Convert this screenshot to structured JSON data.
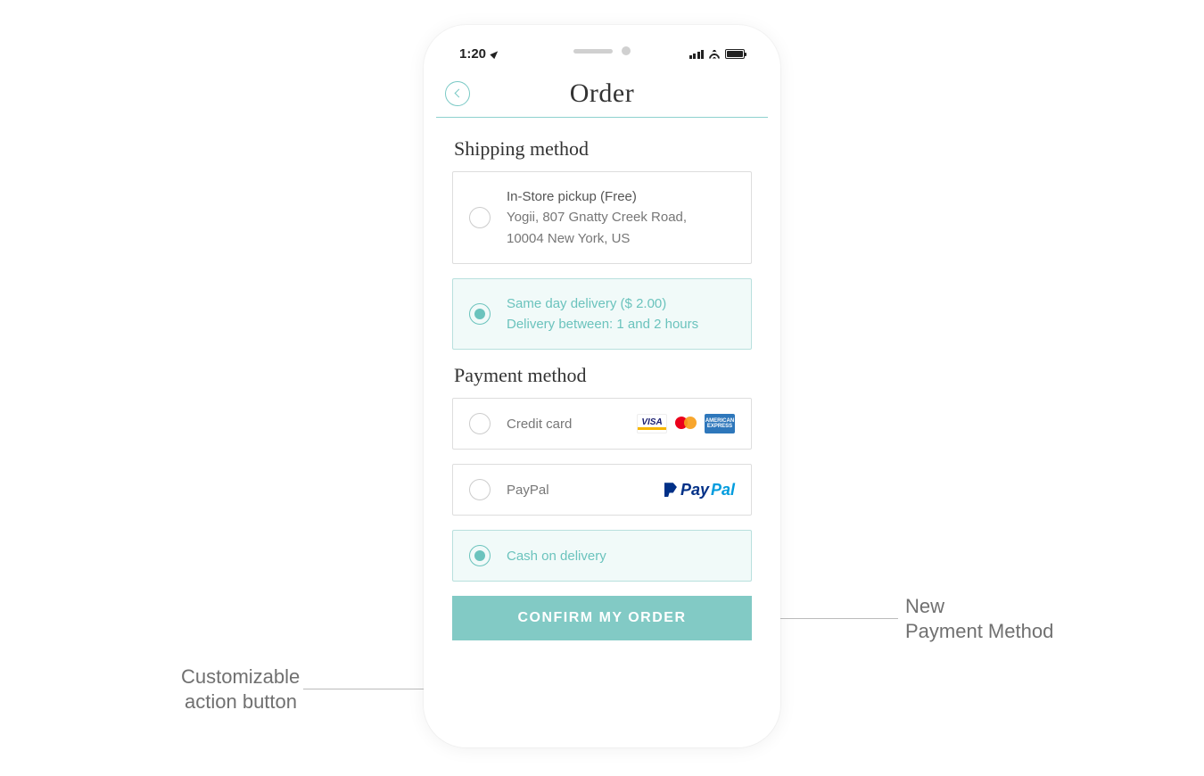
{
  "status": {
    "time": "1:20"
  },
  "header": {
    "title": "Order"
  },
  "shipping": {
    "title": "Shipping method",
    "options": [
      {
        "title": "In-Store pickup (Free)",
        "line1": "Yogii, 807 Gnatty Creek Road,",
        "line2": "10004 New York, US",
        "selected": false
      },
      {
        "title": "Same day delivery ($ 2.00)",
        "line1": "Delivery between: 1 and 2 hours",
        "selected": true
      }
    ]
  },
  "payment": {
    "title": "Payment method",
    "options": [
      {
        "label": "Credit card",
        "selected": false,
        "logos": "cards"
      },
      {
        "label": "PayPal",
        "selected": false,
        "logos": "paypal"
      },
      {
        "label": "Cash on delivery",
        "selected": true,
        "logos": "none"
      }
    ]
  },
  "confirm_label": "CONFIRM MY ORDER",
  "callouts": {
    "left_line1": "Customizable",
    "left_line2": "action button",
    "right_line1": "New",
    "right_line2": "Payment Method"
  },
  "logos": {
    "visa": "VISA",
    "amex": "AMERICAN EXPRESS",
    "paypal_a": "Pay",
    "paypal_b": "Pal"
  }
}
